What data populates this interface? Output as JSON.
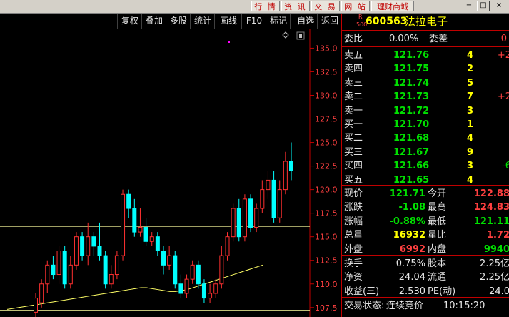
{
  "topbar": {
    "buttons": [
      "行 情",
      "资 讯",
      "交 易",
      "网 站",
      "理财商城"
    ],
    "window_controls": [
      "−",
      "□",
      "×"
    ]
  },
  "toolbar": {
    "items": [
      "复权",
      "叠加",
      "多股",
      "统计",
      "画线",
      "F10",
      "标记",
      "-自选",
      "返回"
    ]
  },
  "chart_data": {
    "type": "candlestick",
    "y_ticks": [
      "135.0",
      "132.5",
      "130.0",
      "127.5",
      "125.0",
      "122.5",
      "120.0",
      "117.5",
      "115.0",
      "112.5",
      "110.0",
      "107.5"
    ],
    "ylim": [
      106.5,
      137.0
    ],
    "hlines": [
      116.1,
      107.2
    ],
    "candles": [
      [
        107,
        108.5,
        106,
        109
      ],
      [
        108,
        110,
        107.5,
        110.5
      ],
      [
        110,
        112,
        109,
        112.5
      ],
      [
        112,
        111,
        110.5,
        113
      ],
      [
        111,
        113.5,
        110,
        114
      ],
      [
        113.5,
        110,
        109.5,
        114
      ],
      [
        110,
        112,
        109.5,
        113
      ],
      [
        112,
        115,
        111.5,
        115.5
      ],
      [
        115,
        113,
        112.5,
        115.5
      ],
      [
        113,
        115,
        112,
        116.5
      ],
      [
        115,
        114,
        113,
        115.5
      ],
      [
        114,
        113,
        112.5,
        116.5
      ],
      [
        113,
        110,
        109.5,
        113.5
      ],
      [
        110,
        111,
        109.5,
        112
      ],
      [
        111,
        113,
        110.5,
        113.5
      ],
      [
        113,
        119.5,
        112.5,
        120
      ],
      [
        119.5,
        118,
        117,
        120
      ],
      [
        118,
        115.5,
        115,
        119
      ],
      [
        115.5,
        116,
        115,
        118
      ],
      [
        116,
        114.5,
        114,
        117
      ],
      [
        114.5,
        115,
        114,
        115.5
      ],
      [
        115,
        113.5,
        113,
        115.5
      ],
      [
        113.5,
        112,
        111,
        114
      ],
      [
        112,
        113,
        111.5,
        114
      ],
      [
        113,
        110,
        109.5,
        113.5
      ],
      [
        110,
        109,
        108.5,
        111
      ],
      [
        109,
        110.5,
        108.5,
        111
      ],
      [
        110.5,
        112,
        110,
        112.5
      ],
      [
        112,
        110,
        109.5,
        112.5
      ],
      [
        110,
        108.5,
        108,
        110.5
      ],
      [
        108.5,
        109,
        108,
        110
      ],
      [
        109,
        110,
        108.5,
        110.5
      ],
      [
        110,
        113,
        109.5,
        114
      ],
      [
        113,
        115,
        112.5,
        115.5
      ],
      [
        115,
        118,
        114.5,
        118.5
      ],
      [
        118,
        115,
        114.5,
        119
      ],
      [
        115,
        119,
        114.5,
        119.5
      ],
      [
        119,
        116,
        115.5,
        119.5
      ],
      [
        116,
        118,
        115.5,
        118.5
      ],
      [
        118,
        120,
        117.5,
        121
      ],
      [
        120,
        121,
        119,
        122
      ],
      [
        121,
        117,
        116.5,
        122
      ],
      [
        117,
        120,
        116.5,
        121
      ],
      [
        120,
        123,
        119.5,
        124
      ],
      [
        123,
        122,
        121,
        125
      ]
    ],
    "ma_line": [
      107.3,
      107.4,
      107.5,
      107.6,
      107.7,
      107.8,
      107.9,
      108,
      108.1,
      108.2,
      108.3,
      108.4,
      108.5,
      108.6,
      108.7,
      108.8,
      108.9,
      109,
      109.1,
      109.2,
      109.3,
      109.4,
      109.5,
      109.6,
      109.6,
      109.5,
      109.4,
      109.3,
      109.2,
      109.2,
      109.3,
      109.4,
      109.6,
      109.8,
      110,
      110.2,
      110.4,
      110.6,
      110.8,
      111,
      111.2,
      111.4,
      111.6,
      111.8,
      112
    ]
  },
  "panel": {
    "stock_code": "600563",
    "stock_name": "法拉电子",
    "badge_r": "R",
    "badge_500": "500",
    "weibi_label": "委比",
    "weibi_value": "0.00%",
    "weicha_label": "委差",
    "weicha_value": "0",
    "asks": [
      {
        "label": "卖五",
        "price": "121.76",
        "vol": "4",
        "chg": "+2"
      },
      {
        "label": "卖四",
        "price": "121.75",
        "vol": "2",
        "chg": ""
      },
      {
        "label": "卖三",
        "price": "121.74",
        "vol": "5",
        "chg": ""
      },
      {
        "label": "卖二",
        "price": "121.73",
        "vol": "7",
        "chg": "+2"
      },
      {
        "label": "卖一",
        "price": "121.72",
        "vol": "3",
        "chg": ""
      }
    ],
    "bids": [
      {
        "label": "买一",
        "price": "121.70",
        "vol": "1",
        "chg": ""
      },
      {
        "label": "买二",
        "price": "121.68",
        "vol": "4",
        "chg": ""
      },
      {
        "label": "买三",
        "price": "121.67",
        "vol": "9",
        "chg": ""
      },
      {
        "label": "买四",
        "price": "121.66",
        "vol": "3",
        "chg": "-6"
      },
      {
        "label": "买五",
        "price": "121.65",
        "vol": "4",
        "chg": ""
      }
    ],
    "stats": [
      {
        "l1": "现价",
        "v1": "121.71",
        "c1": "green",
        "l2": "今开",
        "v2": "122.88",
        "c2": "red"
      },
      {
        "l1": "涨跌",
        "v1": "-1.08",
        "c1": "green",
        "l2": "最高",
        "v2": "124.83",
        "c2": "red"
      },
      {
        "l1": "涨幅",
        "v1": "-0.88%",
        "c1": "green",
        "l2": "最低",
        "v2": "121.11",
        "c2": "green"
      },
      {
        "l1": "总量",
        "v1": "16932",
        "c1": "yellow",
        "l2": "量比",
        "v2": "1.72",
        "c2": "red"
      },
      {
        "l1": "外盘",
        "v1": "6992",
        "c1": "red",
        "l2": "内盘",
        "v2": "9940",
        "c2": "green"
      }
    ],
    "stats2": [
      {
        "l1": "换手",
        "v1": "0.75%",
        "l2": "股本",
        "v2": "2.25亿"
      },
      {
        "l1": "净资",
        "v1": "24.04",
        "l2": "流通",
        "v2": "2.25亿"
      },
      {
        "l1": "收益(三)",
        "v1": "2.530",
        "l2": "PE(动)",
        "v2": "24.0"
      }
    ],
    "trade_status_label": "交易状态:",
    "trade_status_value": "连续竞价",
    "trade_time": "10:15:20"
  }
}
